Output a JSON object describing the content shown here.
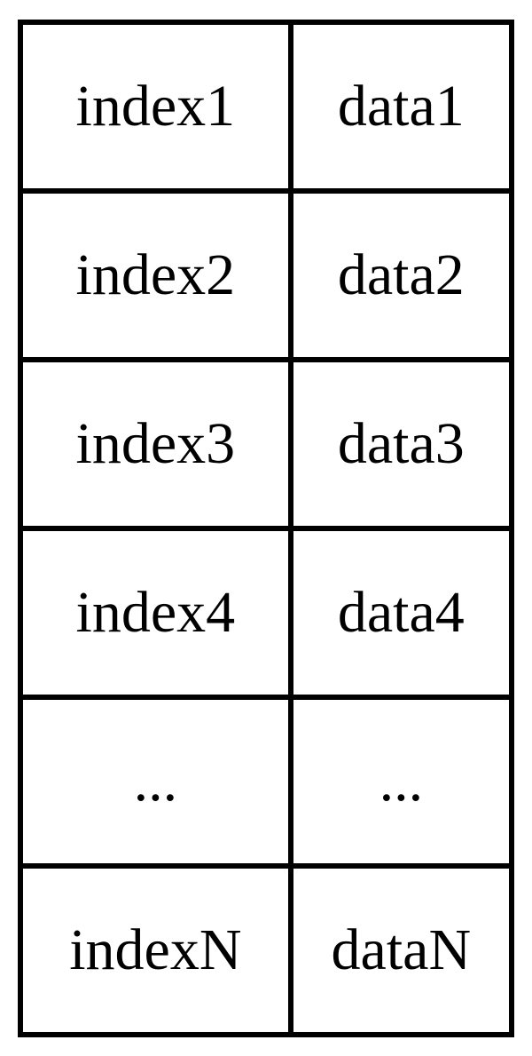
{
  "rows": [
    {
      "index": "index1",
      "data": "data1"
    },
    {
      "index": "index2",
      "data": "data2"
    },
    {
      "index": "index3",
      "data": "data3"
    },
    {
      "index": "index4",
      "data": "data4"
    },
    {
      "index": "...",
      "data": "..."
    },
    {
      "index": "indexN",
      "data": "dataN"
    }
  ]
}
